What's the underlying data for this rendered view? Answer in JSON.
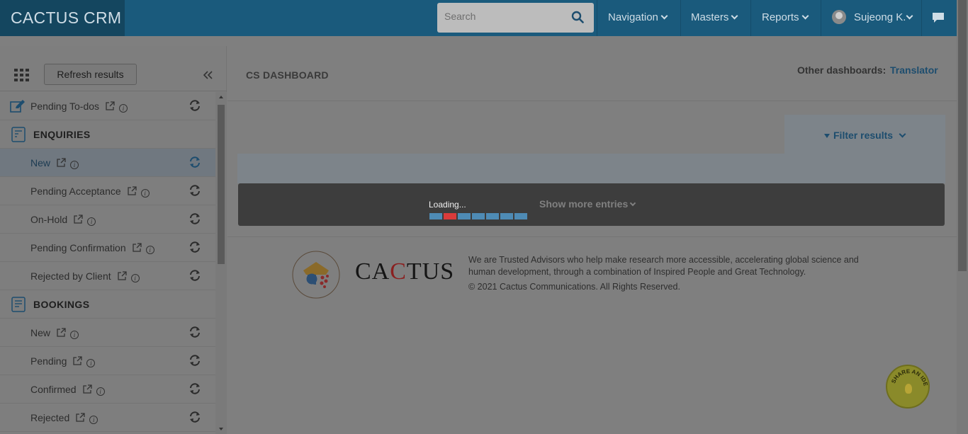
{
  "app": {
    "title": "CACTUS CRM"
  },
  "header": {
    "search_placeholder": "Search",
    "nav": [
      {
        "label": "Navigation"
      },
      {
        "label": "Masters"
      },
      {
        "label": "Reports"
      }
    ],
    "user": "Sujeong K."
  },
  "sidebar": {
    "refresh_label": "Refresh results",
    "items": [
      {
        "label": "Pending To-dos",
        "type": "item"
      },
      {
        "label": "ENQUIRIES",
        "type": "section"
      },
      {
        "label": "New",
        "type": "item",
        "active": true
      },
      {
        "label": "Pending Acceptance",
        "type": "item"
      },
      {
        "label": "On-Hold",
        "type": "item"
      },
      {
        "label": "Pending Confirmation",
        "type": "item"
      },
      {
        "label": "Rejected by Client",
        "type": "item"
      },
      {
        "label": "BOOKINGS",
        "type": "section"
      },
      {
        "label": "New",
        "type": "item"
      },
      {
        "label": "Pending",
        "type": "item"
      },
      {
        "label": "Confirmed",
        "type": "item"
      },
      {
        "label": "Rejected",
        "type": "item"
      }
    ]
  },
  "main": {
    "title": "CS DASHBOARD",
    "other_label": "Other dashboards:",
    "other_link": "Translator",
    "filter_label": "Filter results",
    "loading_text": "Loading...",
    "show_more": "Show more entries"
  },
  "footer": {
    "brand": "CACTUS",
    "description": "We are Trusted Advisors who help make research more accessible, accelerating global science and human development, through a combination of Inspired People and Great Technology.",
    "copyright": "© 2021 Cactus Communications. All Rights Reserved."
  },
  "idea_badge": {
    "label": "SHARE AN IDEA"
  },
  "colors": {
    "navbar": "#1a5a7c",
    "accent": "#1d4d6e",
    "progress": "#4e8bb5",
    "progress_active": "#d93b3b"
  }
}
